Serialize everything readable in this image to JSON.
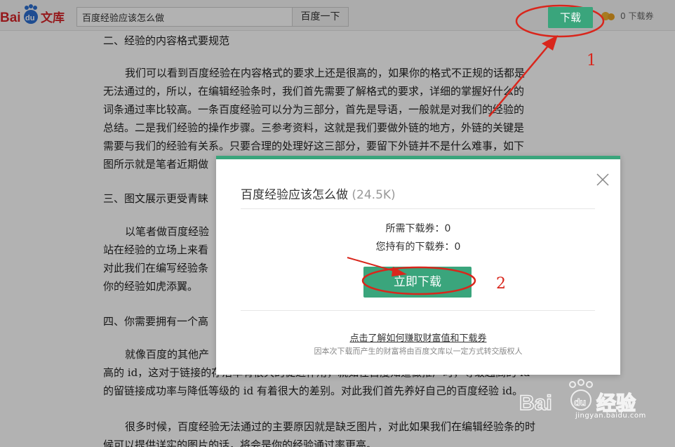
{
  "header": {
    "logo_text": "Bai du 文库",
    "search_value": "百度经验应该怎么做",
    "search_button": "百度一下",
    "download_button": "下载",
    "coupon_text": "0 下载券"
  },
  "article": {
    "heading2": "二、经验的内容格式要规范",
    "para1": [
      "我们可以看到百度经验在内容格式的要求上还是很高的，如果你的格式不正规的话都是",
      "无法通过的，所以，在编辑经验条时，我们首先需要了解格式的要求，详细的掌握好什么的",
      "词条通过率比较高。一条百度经验可以分为三部分，首先是导语，一般就是对我们的经验的",
      "总结。二是我们经验的操作步骤。三参考资料，这就是我们要做外链的地方，外链的关键是",
      "需要与我们的经验有关系。只要合理的处理好这三部分，要留下外链并不是什么难事，如下",
      "图所示就是笔者近期做"
    ],
    "heading3": "三、图文展示更受青睐",
    "para2": [
      "以笔者做百度经验",
      "站在经验的立场上来看",
      "对此我们在编写经验条",
      "你的经验如虎添翼。"
    ],
    "heading4": "四、你需要拥有一个高",
    "para3": [
      "就像百度的其他产",
      "高的 id，这对于链接的存活率有很大的促进作用，就如在百度知道做推广时，等级越高的 id",
      "的留链接成功率与降低等级的 id 有着很大的差别。对此我们首先养好自己的百度经验 id。"
    ],
    "para4": [
      "很多时候，百度经验无法通过的主要原因就是缺乏图片，对此如果我们在编辑经验条的时",
      "候可以提供详实的图片的话，将会是你的经验通过率更高。"
    ]
  },
  "modal": {
    "title": "百度经验应该怎么做",
    "size": "(24.5K)",
    "required_label": "所需下载券：0",
    "owned_label": "您持有的下载券：0",
    "download_now": "立即下载",
    "earn_link": "点击了解如何赚取财富值和下载券",
    "note": "因本次下载而产生的财富将由百度文库以一定方式转交版权人"
  },
  "annotations": {
    "step1": "1",
    "step2": "2",
    "color": "#d9261c"
  },
  "watermark": {
    "brand": "Bai du 经验",
    "url": "jingyan.baidu.com"
  },
  "colors": {
    "accent": "#3aa57c",
    "annotation": "#d9261c"
  }
}
